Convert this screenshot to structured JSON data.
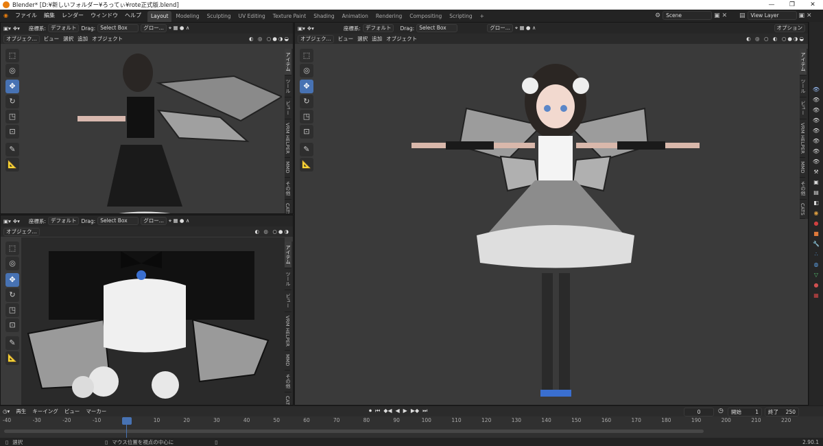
{
  "window": {
    "title": "Blender* [D:¥新しいフォルダー¥ろってぃ¥rote正式版.blend]",
    "controls": [
      "—",
      "❐",
      "✕"
    ]
  },
  "menu": [
    "ファイル",
    "編集",
    "レンダー",
    "ウィンドウ",
    "ヘルプ"
  ],
  "workspaces": [
    "Layout",
    "Modeling",
    "Sculpting",
    "UV Editing",
    "Texture Paint",
    "Shading",
    "Animation",
    "Rendering",
    "Compositing",
    "Scripting",
    "+"
  ],
  "active_workspace": "Layout",
  "scene": {
    "name": "Scene",
    "view_layer": "View Layer"
  },
  "viewport_header": {
    "coord_label": "座標系:",
    "coord_value": "デフォルト",
    "drag_label": "Drag:",
    "drag_value": "Select Box",
    "global": "グロー..."
  },
  "viewport_menus": [
    "オブジェク...",
    "ビュー",
    "選択",
    "追加",
    "オブジェクト"
  ],
  "options_label": "オプション",
  "side_tabs": [
    "アイテム",
    "ツール",
    "ビュー",
    "VRM HELPER",
    "MMD",
    "その他",
    "CATS"
  ],
  "timeline": {
    "menus": [
      "再生",
      "キーイング",
      "ビュー",
      "マーカー"
    ],
    "current_frame": "0",
    "start_label": "開始",
    "start_value": "1",
    "end_label": "終了",
    "end_value": "250",
    "ticks": [
      "-40",
      "-30",
      "-20",
      "-10",
      "0",
      "10",
      "20",
      "30",
      "40",
      "50",
      "60",
      "70",
      "80",
      "90",
      "100",
      "110",
      "120",
      "130",
      "140",
      "150",
      "160",
      "170",
      "180",
      "190",
      "200",
      "210",
      "220"
    ]
  },
  "status": {
    "left": "選択",
    "middle": "マウス位置を視点の中心に",
    "version": "2.90.1"
  },
  "colors": {
    "accent": "#4772b3",
    "viewport_bg": "#3a3a3a",
    "header_bg": "#262626",
    "logo": "#e87d0d"
  }
}
